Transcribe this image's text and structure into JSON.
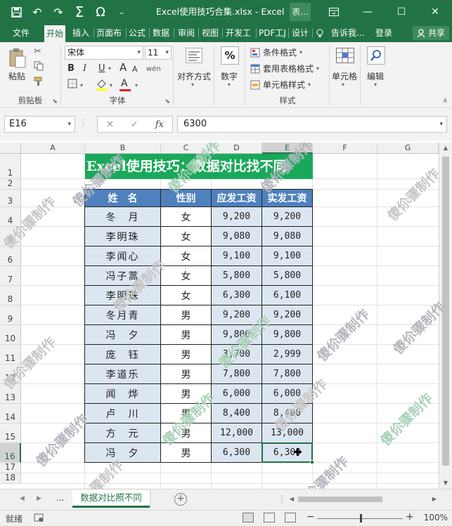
{
  "window": {
    "title": "Excel使用技巧合集.xlsx - Excel",
    "context_tab": "表...",
    "minimize": "—",
    "restore": "❐",
    "maximize": "☐",
    "close": "✕"
  },
  "qat": {
    "save": "💾",
    "undo": "↶",
    "redo": "↷",
    "sum": "Σ",
    "omega": "Ω",
    "more": "₌"
  },
  "tabs": [
    {
      "label": "文件"
    },
    {
      "label": "开始"
    },
    {
      "label": "插入"
    },
    {
      "label": "页面布"
    },
    {
      "label": "公式"
    },
    {
      "label": "数据"
    },
    {
      "label": "审阅"
    },
    {
      "label": "视图"
    },
    {
      "label": "开发工"
    },
    {
      "label": "PDF工J"
    },
    {
      "label": "设计"
    },
    {
      "label": "告诉我..."
    },
    {
      "label": "登录"
    }
  ],
  "share_label": "共享",
  "ribbon": {
    "clipboard": {
      "paste": "粘贴",
      "group": "剪贴板"
    },
    "font": {
      "name": "宋体",
      "size": "11",
      "bold": "B",
      "italic": "I",
      "underline": "U",
      "grow": "A",
      "shrink": "A",
      "wen": "wén",
      "fill": "A",
      "color": "A",
      "group": "字体"
    },
    "align": {
      "label": "对齐方式"
    },
    "number": {
      "label": "数字",
      "icon": "%"
    },
    "styles": {
      "cond": "条件格式",
      "table": "套用表格格式",
      "cell": "单元格样式",
      "group": "样式"
    },
    "cells": {
      "label": "单元格"
    },
    "edit": {
      "label": "编辑"
    }
  },
  "formula_bar": {
    "name_box": "E16",
    "cancel": "✕",
    "enter": "✓",
    "fx": "fx",
    "value": "6300"
  },
  "columns": [
    "A",
    "B",
    "C",
    "D",
    "E",
    "F",
    "G"
  ],
  "rows": [
    "1",
    "2",
    "3",
    "4",
    "5",
    "6",
    "7",
    "8",
    "9",
    "10",
    "11",
    "12",
    "13",
    "14",
    "15",
    "16",
    "17",
    "18"
  ],
  "table": {
    "banner": "Excel使用技巧：数据对比找不同",
    "headers": [
      "姓　名",
      "性别",
      "应发工资",
      "实发工资"
    ],
    "data": [
      [
        "冬　月",
        "女",
        "9,200",
        "9,200"
      ],
      [
        "李明珠",
        "女",
        "9,080",
        "9,080"
      ],
      [
        "李闻心",
        "女",
        "9,100",
        "9,100"
      ],
      [
        "冯子蒿",
        "女",
        "5,800",
        "5,800"
      ],
      [
        "李明珠",
        "女",
        "6,300",
        "6,100"
      ],
      [
        "冬月青",
        "男",
        "9,200",
        "9,200"
      ],
      [
        "冯　夕",
        "男",
        "9,800",
        "9,800"
      ],
      [
        "庞　钰",
        "男",
        "3,700",
        "2,999"
      ],
      [
        "李道乐",
        "男",
        "7,800",
        "7,800"
      ],
      [
        "闻　烨",
        "男",
        "6,000",
        "6,000"
      ],
      [
        "卢　川",
        "男",
        "8,400",
        "8,400"
      ],
      [
        "方　元",
        "男",
        "12,000",
        "13,000"
      ],
      [
        "冯　夕",
        "男",
        "6,300",
        "6,300"
      ]
    ]
  },
  "watermark": "傻伱骤制作",
  "sheet": {
    "tab": "数据对比照不同",
    "more": "...",
    "add": "+"
  },
  "status": {
    "ready": "就绪",
    "zoom": "100%"
  }
}
